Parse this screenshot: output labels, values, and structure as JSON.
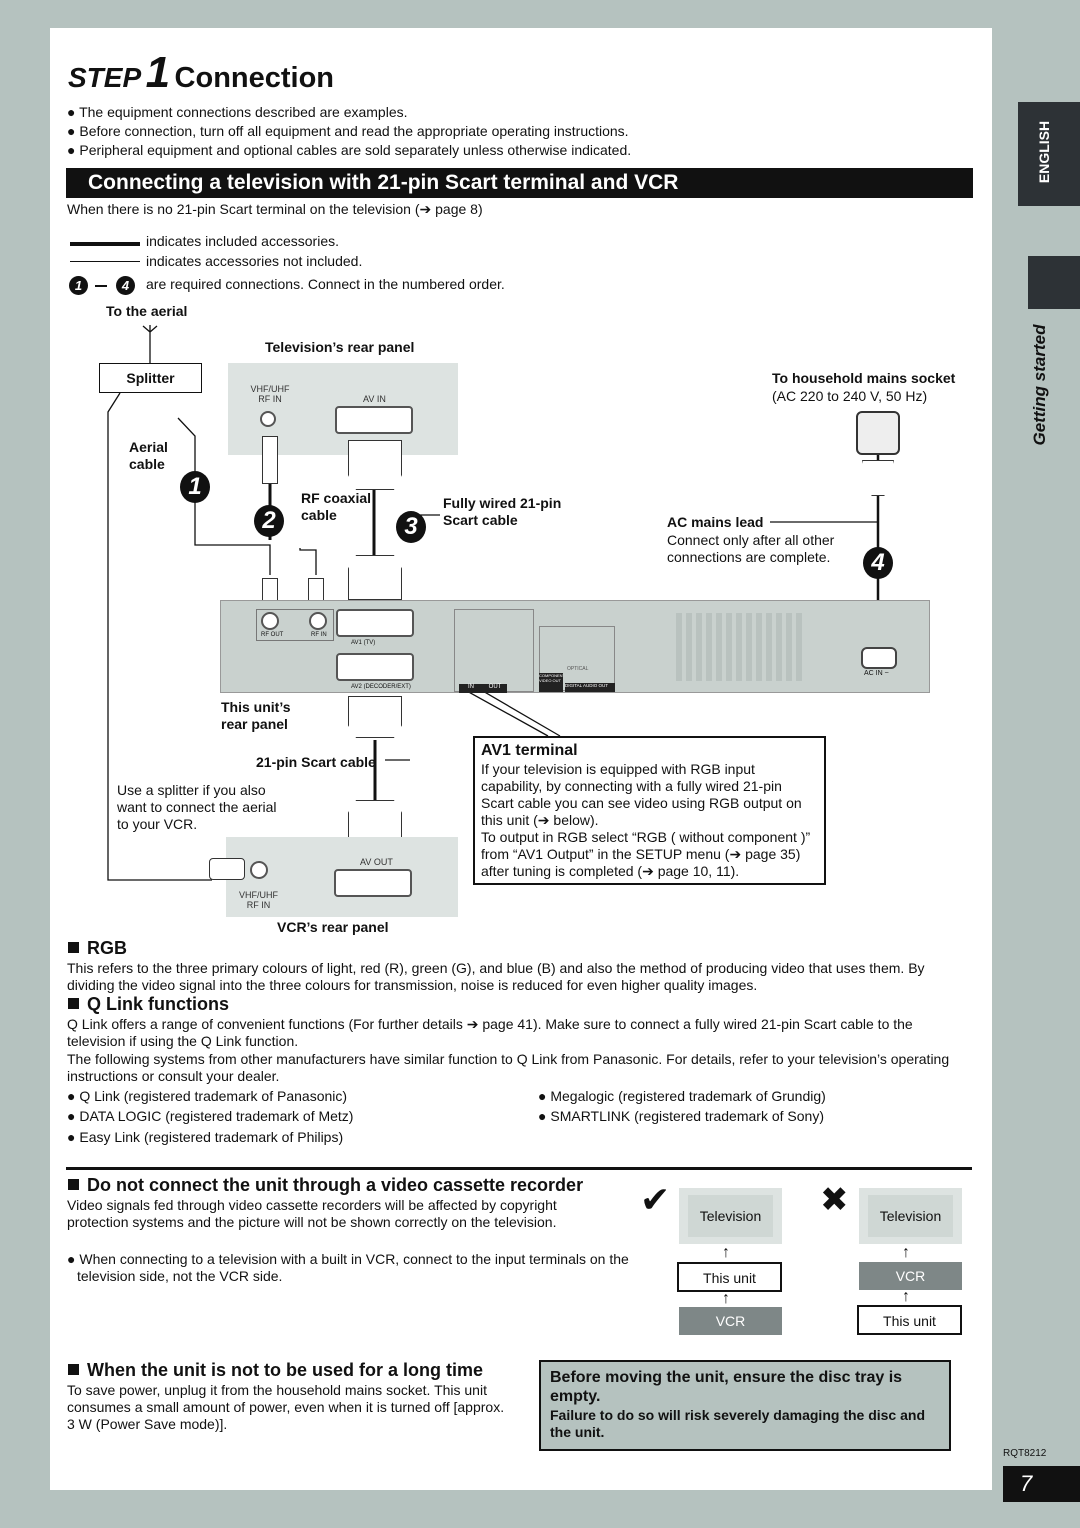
{
  "header": {
    "step": "STEP",
    "step_num": "1",
    "title": "Connection"
  },
  "intro_bullets": [
    "The equipment connections described are examples.",
    "Before connection, turn off all equipment and read the appropriate operating instructions.",
    "Peripheral equipment and optional cables are sold separately unless otherwise indicated."
  ],
  "banner": "Connecting a television with 21-pin Scart terminal and VCR",
  "banner_note": "When there is no 21-pin Scart terminal on the television (➔ page 8)",
  "legend": {
    "included": "indicates included accessories.",
    "not_included": "indicates accessories not included.",
    "num_from": "1",
    "num_to": "4",
    "numbered": "are required connections. Connect in the numbered order."
  },
  "diagram": {
    "to_aerial": "To the aerial",
    "splitter": "Splitter",
    "aerial_cable": "Aerial cable",
    "tv_panel": "Television’s rear panel",
    "tv_rf": "VHF/UHF RF IN",
    "tv_avin": "AV IN",
    "rf_coax": "RF coaxial cable",
    "scart_full": "Fully wired 21-pin Scart cable",
    "mains": "To household mains socket",
    "mains_spec": "(AC 220 to 240 V, 50 Hz)",
    "ac_lead": "AC mains lead",
    "ac_note": "Connect only after all other connections are complete.",
    "unit_rf_out": "RF OUT",
    "unit_rf_in": "RF IN",
    "unit_av1": "AV1 (TV)",
    "unit_av2": "AV2 (DECODER/EXT)",
    "unit_acin": "AC IN ~",
    "unit_in": "IN",
    "unit_out": "OUT",
    "unit_component": "COMPONENT VIDEO OUT",
    "unit_digital": "DIGITAL AUDIO OUT",
    "unit_optical": "OPTICAL",
    "unit_panel": "This unit’s rear panel",
    "scart21": "21-pin Scart cable",
    "splitter_note": "Use a splitter if you also want to connect the aerial to your VCR.",
    "vcr_avout": "AV OUT",
    "vcr_rf": "VHF/UHF RF IN",
    "vcr_panel": "VCR’s rear panel",
    "steps": [
      "1",
      "2",
      "3",
      "4"
    ]
  },
  "av1": {
    "title": "AV1 terminal",
    "text1": "If your television is equipped with RGB input capability, by connecting with a fully wired 21-pin Scart cable you can see video using RGB output on this unit (➔ below).",
    "text2": "To output in RGB select “RGB ( without component )” from “AV1 Output” in the SETUP menu (➔ page 35) after tuning is completed (➔ page 10, 11)."
  },
  "rgb": {
    "title": "RGB",
    "text": "This refers to the three primary colours of light, red (R), green (G), and blue (B) and also the method of producing video that uses them. By dividing the video signal into the three colours for transmission, noise is reduced for even higher quality images."
  },
  "qlink": {
    "title": "Q Link functions",
    "p1": "Q Link offers a range of convenient functions (For further details ➔ page 41). Make sure to connect a fully wired 21-pin Scart cable to the television if using the Q Link function.",
    "p2": "The following systems from other manufacturers have similar function to Q Link from Panasonic. For details, refer to your television’s operating instructions or consult your dealer.",
    "items": [
      "Q Link (registered trademark of Panasonic)",
      "DATA LOGIC (registered trademark of Metz)",
      "Easy Link (registered trademark of Philips)",
      "Megalogic (registered trademark of Grundig)",
      "SMARTLINK (registered trademark of Sony)"
    ]
  },
  "vcr_section": {
    "title": "Do not connect the unit through a video cassette recorder",
    "text": "Video signals fed through video cassette recorders will be affected by copyright protection systems and the picture will not be shown correctly on the television.",
    "bullet": "When connecting to a television with a built in VCR, connect to the input terminals on the television side, not the VCR side.",
    "correct": {
      "mark": "✔",
      "top": "Television",
      "mid": "This unit",
      "bottom": "VCR"
    },
    "wrong": {
      "mark": "✖",
      "top": "Television",
      "mid": "VCR",
      "bottom": "This unit"
    }
  },
  "longtime": {
    "title": "When the unit is not to be used for a long time",
    "text": "To save power, unplug it from the household mains socket. This unit consumes a small amount of power, even when it is turned off [approx. 3 W (Power Save mode)]."
  },
  "warning": {
    "line1": "Before moving the unit, ensure the disc tray is empty.",
    "line2": "Failure to do so will risk severely damaging the disc and the unit."
  },
  "side": {
    "language": "ENGLISH",
    "section": "Getting started"
  },
  "footer": {
    "code": "RQT8212",
    "page": "7"
  },
  "colors": {
    "background": "#b5c2bf",
    "dark_tab": "#2d3236",
    "panel_gray": "#dde3e1",
    "warning_bg": "#b5c2bf"
  }
}
